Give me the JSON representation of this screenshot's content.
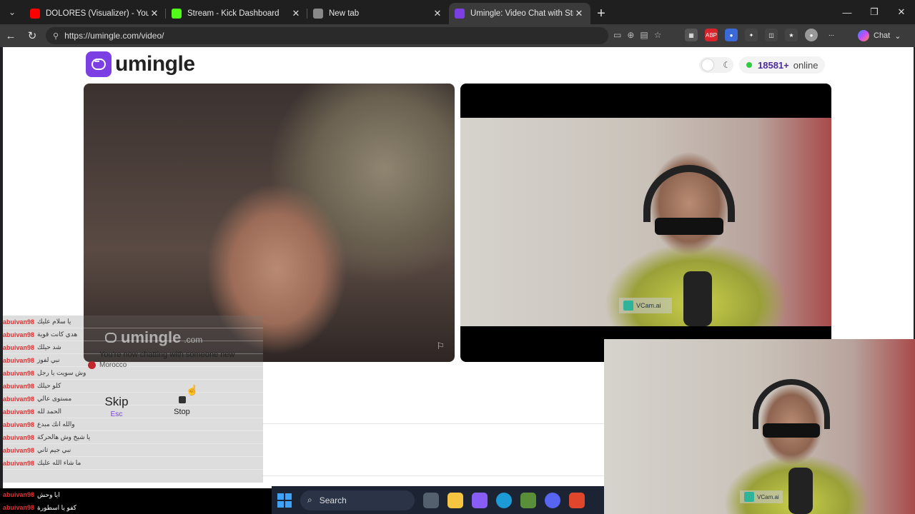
{
  "browser": {
    "tabs": [
      {
        "title": "DOLORES (Visualizer) - YouTube",
        "favicon_color": "#ff0000"
      },
      {
        "title": "Stream - Kick Dashboard",
        "favicon_color": "#53fc18"
      },
      {
        "title": "New tab",
        "favicon_color": "#888888"
      },
      {
        "title": "Umingle: Video Chat with Stra",
        "favicon_color": "#7b3fe4"
      }
    ],
    "url": "https://umingle.com/video/",
    "chat_label": "Chat"
  },
  "site": {
    "logo_text": "umingle",
    "online_count": "18581+",
    "online_label": "online",
    "watermark_text": "umingle",
    "watermark_suffix": ".com",
    "vcam_label": "VCam.ai",
    "system_message": "You're now chatting with someone new",
    "country": "Morocco",
    "skip_label": "Skip",
    "skip_shortcut": "Esc",
    "stop_label": "Stop"
  },
  "stream_chat": {
    "rows": [
      {
        "user": "abuivan98",
        "message": "يا سلام عليك"
      },
      {
        "user": "abuivan98",
        "message": "هدي كانت قوية"
      },
      {
        "user": "abuivan98",
        "message": "شد حيلك"
      },
      {
        "user": "abuivan98",
        "message": "نبي لفوز"
      },
      {
        "user": "abuivan98",
        "message": "وش سويت يا رجل"
      },
      {
        "user": "abuivan98",
        "message": "كلو حيلك"
      },
      {
        "user": "abuivan98",
        "message": "مستوى عالي"
      },
      {
        "user": "abuivan98",
        "message": "الحمد لله"
      },
      {
        "user": "abuivan98",
        "message": "والله انك مبدع"
      },
      {
        "user": "abuivan98",
        "message": "يا شيخ وش هالحركة"
      },
      {
        "user": "abuivan98",
        "message": "نبي جيم ثاني"
      },
      {
        "user": "abuivan98",
        "message": "ما شاء الله عليك"
      }
    ],
    "bottom_rows": [
      {
        "user": "abuivan98",
        "message": "ايا وحش"
      },
      {
        "user": "abuivan98",
        "message": "كفو يا اسطورة"
      }
    ]
  },
  "taskbar": {
    "search_label": "Search"
  }
}
